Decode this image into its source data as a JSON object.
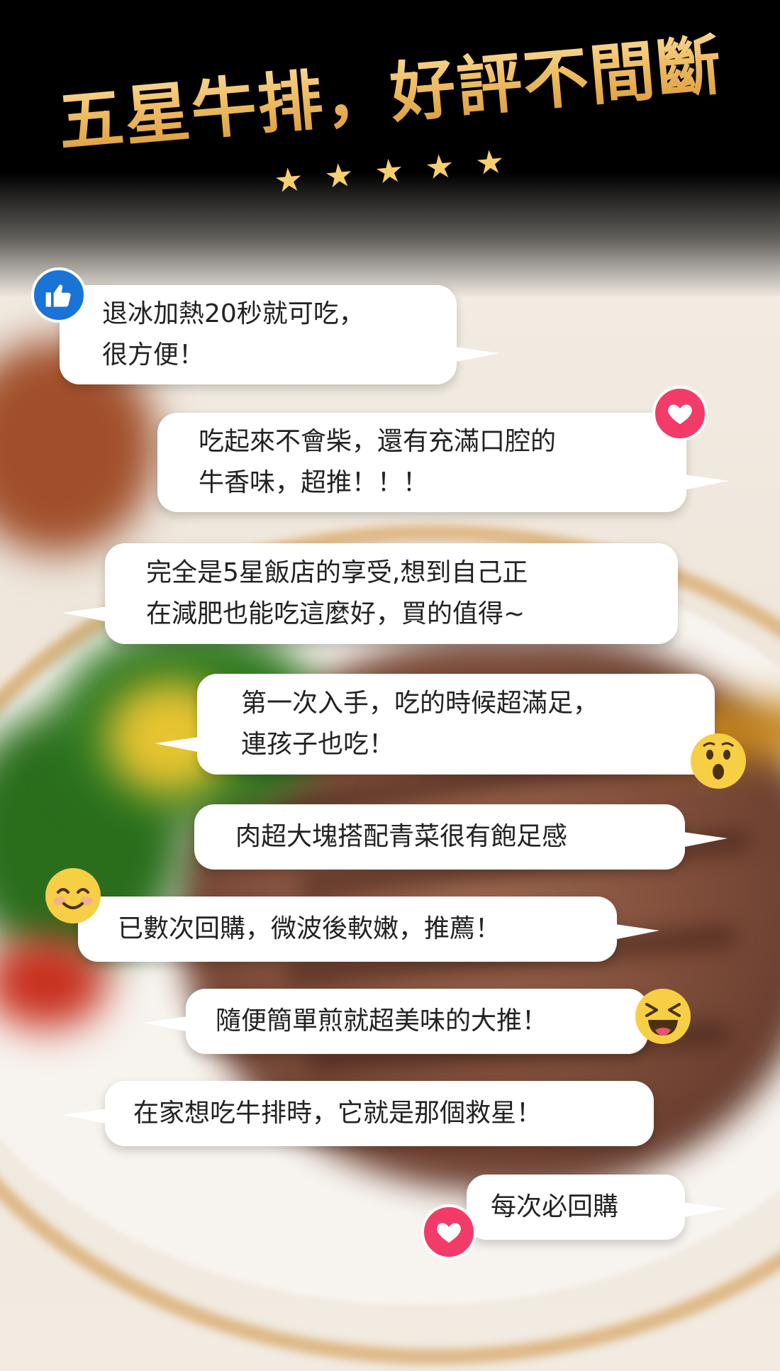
{
  "header": {
    "title": "五星牛排，好評不間斷",
    "stars": [
      "★",
      "★",
      "★",
      "★",
      "★"
    ]
  },
  "reviews": [
    {
      "lines": [
        "退冰加熱20秒就可吃，",
        "很方便！"
      ],
      "icon": "thumbs-up-icon"
    },
    {
      "lines": [
        "吃起來不會柴，還有充滿口腔的",
        "牛香味，超推！！！"
      ],
      "icon": "heart-icon"
    },
    {
      "lines": [
        "完全是5星飯店的享受,想到自己正",
        "在減肥也能吃這麼好，買的值得~"
      ],
      "icon": ""
    },
    {
      "lines": [
        "第一次入手，吃的時候超滿足，",
        "連孩子也吃！"
      ],
      "icon": "surprised-face-icon"
    },
    {
      "lines": [
        "肉超大塊搭配青菜很有飽足感"
      ],
      "icon": ""
    },
    {
      "lines": [
        "已數次回購，微波後軟嫩，推薦！"
      ],
      "icon": "smiling-face-icon"
    },
    {
      "lines": [
        "隨便簡單煎就超美味的大推！"
      ],
      "icon": "laughing-face-icon"
    },
    {
      "lines": [
        "在家想吃牛排時，它就是那個救星！"
      ],
      "icon": ""
    },
    {
      "lines": [
        "每次必回購"
      ],
      "icon": "heart-icon"
    }
  ],
  "colors": {
    "title_gold": "#f0c068",
    "like_blue": "#1a73d6",
    "heart_pink": "#f33b6a",
    "emoji_yellow": "#f7cf45"
  }
}
